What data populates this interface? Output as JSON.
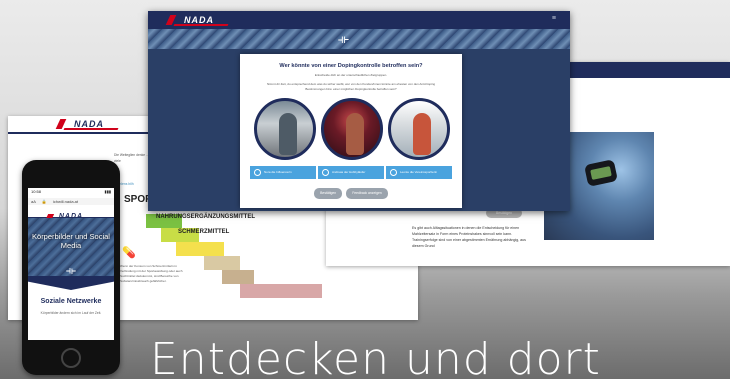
{
  "brand": {
    "logo_text": "NADA",
    "navy": "#1f2c5c",
    "red": "#d0021b",
    "accent_blue": "#4aa3de"
  },
  "banner": {
    "text": "Entdecken und dort"
  },
  "left_screen": {
    "intro_text": "Die Weiteglien denke ... zu schaffen. In viele",
    "link_text": "Empfehlens bilh",
    "staircase": {
      "heading": "SPORT",
      "step_1": "NAHRUNGSERGÄNZUNGSMITTEL",
      "step_2": "SCHMERZMITTEL"
    },
    "note": "Wenn der Konsum von Schmerzmitteln in Verbindung mit der Sportausübung oder auch Suchtmittel dazukommt, sind Bereiche von Substanzmissbrauch gefährlicher."
  },
  "phone": {
    "time": "10:58",
    "url": "ichwill.nada.at",
    "aa": "aA",
    "hero_caption": "Körperbilder und Social Media",
    "section_title": "Soziale Netzwerke",
    "section_sub": "Körperbilder ändern sich im Lauf der Zeit."
  },
  "right_screen": {
    "button_label": "Bestätigen",
    "body_text": "Es gibt auch Alltagssituationen in denen die Entscheidung für einen Mahlzeitersatz in Form eines Proteinshakes sinnvoll sein kann. Trainingserfolge sind von einer abgestimmten Ernährung abhängig, aus diesem Grund"
  },
  "front_screen": {
    "menu_icon": "hamburger-menu-icon",
    "modal": {
      "title": "Wer könnte von einer Dopingkontrolle betroffen sein?",
      "text_1": "Entscheide dich an der unterschiedlichen Zielgruppen.",
      "text_2": "Nimmt dir Zeit, du entsprechend dem was du sicher weißt, wer von den Kunden/innen könnte am ehesten von den Anti-Doping Bestimmungen bzw. einer möglichen Dopingkontrolle betroffen sein?",
      "options": [
        "Nora die Influencerin",
        "Andreas der Hobbyläufer",
        "Leonie die Vereinssportlerin"
      ],
      "confirm_label": "Bestätigen",
      "feedback_label": "Feedback anzeigen"
    }
  }
}
